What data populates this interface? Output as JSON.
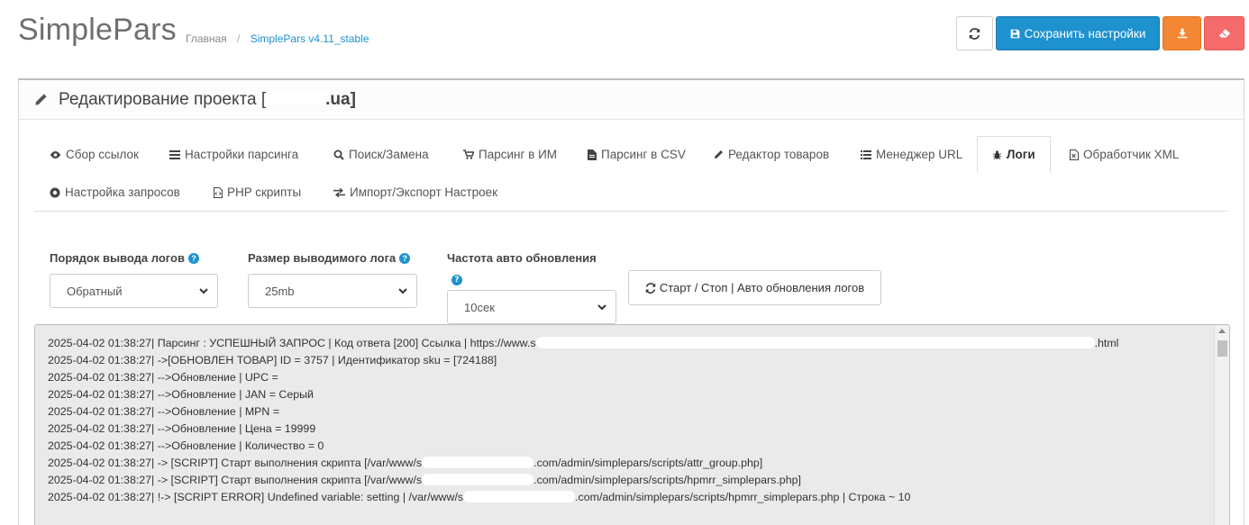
{
  "header": {
    "app_title": "SimplePars",
    "breadcrumb": [
      "Главная",
      "SimplePars v4.11_stable"
    ],
    "buttons": {
      "refresh_icon": "refresh-icon",
      "save_label": "Сохранить настройки",
      "download_icon": "download-icon",
      "erase_icon": "eraser-icon"
    }
  },
  "panel": {
    "title_prefix": "Редактирование проекта [",
    "title_suffix": ".ua]"
  },
  "tabs": [
    {
      "label": "Сбор ссылок",
      "icon": "eye-icon"
    },
    {
      "label": "Настройки парсинга",
      "icon": "list-icon"
    },
    {
      "label": "Поиск/Замена",
      "icon": "search-icon"
    },
    {
      "label": "Парсинг в ИМ",
      "icon": "cart-icon"
    },
    {
      "label": "Парсинг в CSV",
      "icon": "file-icon"
    },
    {
      "label": "Редактор товаров",
      "icon": "pencil-icon"
    },
    {
      "label": "Менеджер URL",
      "icon": "list-icon"
    },
    {
      "label": "Логи",
      "icon": "bug-icon",
      "active": true
    },
    {
      "label": "Обработчик XML",
      "icon": "xml-file-icon"
    },
    {
      "label": "Настройка запросов",
      "icon": "chrome-icon"
    },
    {
      "label": "PHP скрипты",
      "icon": "code-file-icon"
    },
    {
      "label": "Импорт/Экспорт Настроек",
      "icon": "exchange-icon"
    }
  ],
  "controls": {
    "order_label": "Порядок вывода логов",
    "order_value": "Обратный",
    "size_label": "Размер выводимого лога",
    "size_value": "25mb",
    "freq_label": "Частота авто обновления",
    "freq_value": "10сек",
    "auto_button": "Старт / Стоп | Авто обновления логов"
  },
  "log_lines": [
    [
      "2025-04-02 01:38:27| Парсинг : УСПЕШНЫЙ ЗАПРОС  | Код ответа [200] Ссылка | https://www.s",
      ".html"
    ],
    [
      "2025-04-02 01:38:27| ->[ОБНОВЛЕН ТОВАР] ID = 3757 | Идентификатор sku = [724188]"
    ],
    [
      "2025-04-02 01:38:27| -->Обновление | UPC ="
    ],
    [
      "2025-04-02 01:38:27| -->Обновление | JAN = Серый"
    ],
    [
      "2025-04-02 01:38:27| -->Обновление | MPN ="
    ],
    [
      "2025-04-02 01:38:27| -->Обновление | Цена = 19999"
    ],
    [
      "2025-04-02 01:38:27| -->Обновление | Количество = 0"
    ],
    [
      "2025-04-02 01:38:27| -> [SCRIPT] Старт выполнения скрипта [/var/www/s",
      ".com/admin/simplepars/scripts/attr_group.php]"
    ],
    [
      "2025-04-02 01:38:27| -> [SCRIPT] Старт выполнения скрипта [/var/www/s",
      ".com/admin/simplepars/scripts/hpmrr_simplepars.php]"
    ],
    [
      "2025-04-02 01:38:27| !-> [SCRIPT ERROR] Undefined variable: setting | /var/www/s",
      ".com/admin/simplepars/scripts/hpmrr_simplepars.php | Строка ~ 10"
    ]
  ]
}
